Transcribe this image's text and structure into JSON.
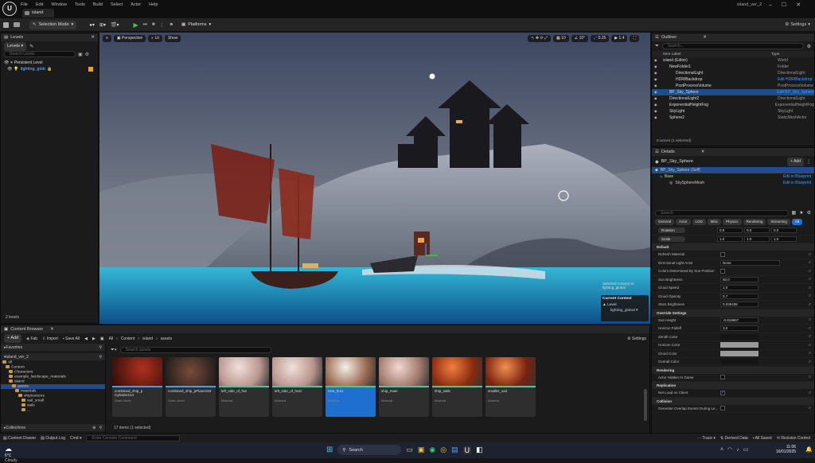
{
  "menu": [
    "File",
    "Edit",
    "Window",
    "Tools",
    "Build",
    "Select",
    "Actor",
    "Help"
  ],
  "doc_tab": "island",
  "project_name": "island_ver_2",
  "toolbar": {
    "mode": "Selection Mode",
    "platforms": "Platforms",
    "settings": "Settings"
  },
  "levels_panel": {
    "tab": "Levels",
    "levels_btn": "Levels",
    "search_placeholder": "Search Levels",
    "items": [
      "Persistent Level",
      "lighting_glob"
    ],
    "footer": "2 levels"
  },
  "viewport": {
    "perspective": "Perspective",
    "lit": "Lit",
    "show": "Show",
    "grid": "10",
    "rot": "10°",
    "scale": "0.25",
    "cam": "1.4",
    "selected_info": "Selected Actor(s) in:\nlighting_global",
    "current_context": "Current Context",
    "level_label": "Level",
    "level_value": "lighting_global"
  },
  "outliner": {
    "tab": "Outliner",
    "search_placeholder": "Search...",
    "col_label": "Item Label",
    "col_type": "Type",
    "rows": [
      {
        "label": "island (Editor)",
        "type": "World"
      },
      {
        "label": "NewFolder1",
        "type": "Folder"
      },
      {
        "label": "DirectionalLight",
        "type": "DirectionalLight"
      },
      {
        "label": "HDRIBackdrop",
        "type": "Edit HDRIBackdrop"
      },
      {
        "label": "PostProcessVolume",
        "type": "PostProcessVolume"
      },
      {
        "label": "BP_Sky_Sphere",
        "type": "Edit BP_Sky_Sphere"
      },
      {
        "label": "DirectionalLight2",
        "type": "DirectionalLight"
      },
      {
        "label": "ExponentialHeightFog",
        "type": "ExponentialHeightFog"
      },
      {
        "label": "SkyLight",
        "type": "SkyLight"
      },
      {
        "label": "Sphere2",
        "type": "StaticMeshActor"
      }
    ],
    "footer": "8 actors (1 selected)"
  },
  "details": {
    "tab": "Details",
    "object": "BP_Sky_Sphere",
    "add": "+ Add",
    "self": "BP_Sky_Sphere (Self)",
    "edit_bp": "Edit in Blueprint",
    "base": "Base",
    "mesh": "SkySphereMesh",
    "search_placeholder": "Search",
    "tabs": [
      "General",
      "Actor",
      "LOD",
      "Misc",
      "Physics",
      "Rendering",
      "Streaming",
      "All"
    ],
    "transform": [
      {
        "label": "Rotation",
        "v": [
          "0.0",
          "0.0",
          "0.0"
        ]
      },
      {
        "label": "Scale",
        "v": [
          "1.0",
          "1.0",
          "1.0"
        ]
      }
    ],
    "sections": [
      {
        "title": "Default",
        "rows": [
          {
            "label": "Refresh Material",
            "value": ""
          },
          {
            "label": "Directional Light Actor",
            "value": "None"
          },
          {
            "label": "Colors Determined By Sun Position",
            "value": ""
          },
          {
            "label": "Sun Brightness",
            "value": "50.0"
          },
          {
            "label": "Cloud Speed",
            "value": "1.0"
          },
          {
            "label": "Cloud Opacity",
            "value": "0.7"
          },
          {
            "label": "Stars Brightness",
            "value": "0.039438"
          }
        ]
      },
      {
        "title": "Override Settings",
        "rows": [
          {
            "label": "Sun Height",
            "value": "-0.818667"
          },
          {
            "label": "Horizon Falloff",
            "value": "3.0"
          },
          {
            "label": "Zenith Color",
            "value": ""
          },
          {
            "label": "Horizon Color",
            "value": ""
          },
          {
            "label": "Cloud Color",
            "value": ""
          },
          {
            "label": "Overall Color",
            "value": ""
          }
        ]
      },
      {
        "title": "Rendering",
        "rows": [
          {
            "label": "Actor Hidden In Game",
            "value": ""
          }
        ]
      },
      {
        "title": "Replication",
        "rows": [
          {
            "label": "Net Load on Client",
            "value": ""
          }
        ]
      },
      {
        "title": "Collision",
        "rows": [
          {
            "label": "Generate Overlap Events During Le...",
            "value": ""
          }
        ]
      }
    ]
  },
  "content_browser": {
    "tab": "Content Browser",
    "add": "+ Add",
    "fab": "Fab",
    "import": "Import",
    "save_all": "Save All",
    "path": [
      "All",
      "Content",
      "island",
      "assets"
    ],
    "settings": "Settings",
    "favorites": "Favorites",
    "project": "island_ver_2",
    "search_placeholder": "Search assets",
    "tree": [
      "All",
      "Content",
      "Characters",
      "example_landscape_materials",
      "island",
      "assets",
      "materials",
      "shiptextures",
      "sail_small",
      "sails",
      "..."
    ],
    "collections": "Collections",
    "status": "17 items (1 selected)",
    "tiles": [
      {
        "name": "combined_ship_p Cylinder144",
        "type": "Static Mesh"
      },
      {
        "name": "combined_ship_pPlane193",
        "type": "Static Mesh"
      },
      {
        "name": "left_side_of_hut",
        "type": "Material"
      },
      {
        "name": "left_side_of_hut1",
        "type": "Material"
      },
      {
        "name": "new_hut1",
        "type": "Material"
      },
      {
        "name": "ship_main",
        "type": "Material"
      },
      {
        "name": "ship_sails",
        "type": "Material"
      },
      {
        "name": "smaller_sail",
        "type": "Material"
      }
    ]
  },
  "statusbar": {
    "content_drawer": "Content Drawer",
    "output_log": "Output Log",
    "cmd": "Cmd",
    "console_placeholder": "Enter Console Command",
    "trace": "Trace",
    "derived": "Derived Data",
    "saved": "All Saved",
    "revision": "Revision Control"
  },
  "taskbar": {
    "temp": "6°C",
    "weather": "Cloudy",
    "search": "Search",
    "time": "11:06",
    "date": "16/01/2025"
  }
}
